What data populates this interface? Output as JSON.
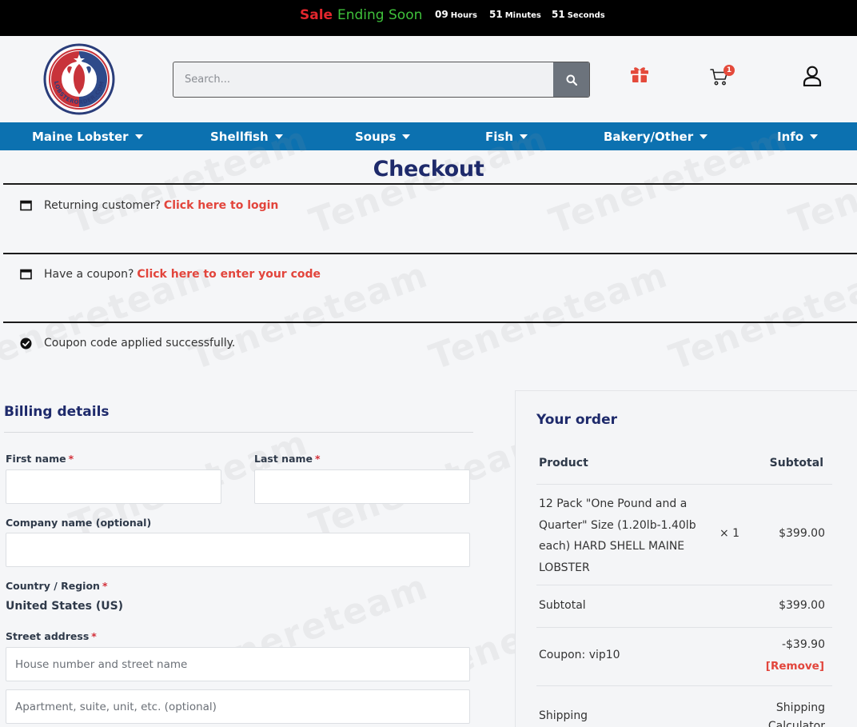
{
  "sale_bar": {
    "sale_word": "Sale",
    "ending_text": "Ending Soon",
    "hours_value": "09",
    "hours_label": "Hours",
    "minutes_value": "51",
    "minutes_label": "Minutes",
    "seconds_value": "51",
    "seconds_label": "Seconds"
  },
  "header": {
    "logo_text": "LOBSTERORDER.COM",
    "search_placeholder": "Search...",
    "cart_count": "1"
  },
  "nav": {
    "items": [
      "Maine Lobster",
      "Shellfish",
      "Soups",
      "Fish",
      "Bakery/Other",
      "Info"
    ]
  },
  "checkout": {
    "title": "Checkout",
    "returning_text": "Returning customer?",
    "login_link": "Click here to login",
    "coupon_text": "Have a coupon?",
    "coupon_link": "Click here to enter your code",
    "coupon_success": "Coupon code applied successfully."
  },
  "billing": {
    "title": "Billing details",
    "first_name_label": "First name",
    "last_name_label": "Last name",
    "company_label": "Company name (optional)",
    "country_label": "Country / Region",
    "country_value": "United States (US)",
    "street_label": "Street address",
    "street_placeholder": "House number and street name",
    "apartment_placeholder": "Apartment, suite, unit, etc. (optional)",
    "required_mark": "*"
  },
  "order": {
    "title": "Your order",
    "col_product": "Product",
    "col_subtotal": "Subtotal",
    "item_name": "12 Pack \"One Pound and a Quarter\" Size (1.20lb-1.40lb each) HARD SHELL MAINE LOBSTER",
    "item_qty": "× 1",
    "item_price": "$399.00",
    "subtotal_label": "Subtotal",
    "subtotal_value": "$399.00",
    "coupon_label": "Coupon: vip10",
    "coupon_value": "-$39.90",
    "remove_link": "[Remove]",
    "shipping_label": "Shipping",
    "shipping_value": "Shipping Calculator"
  },
  "watermark_text": "Tenereteam",
  "colors": {
    "nav_blue": "#0c71b0",
    "title_navy": "#1e2a6b",
    "link_red": "#e2453c",
    "sale_red": "#e3262d",
    "sale_green": "#3fc13b"
  }
}
